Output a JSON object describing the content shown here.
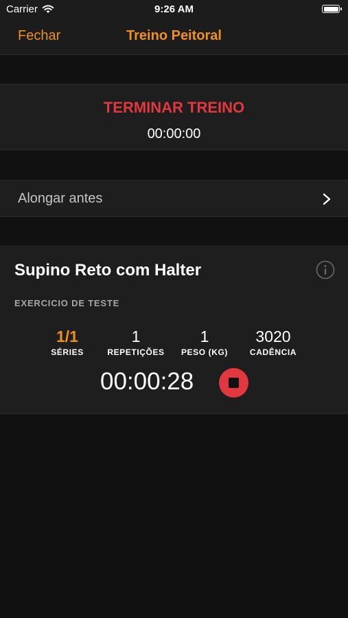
{
  "status_bar": {
    "carrier": "Carrier",
    "time": "9:26 AM"
  },
  "nav": {
    "close_label": "Fechar",
    "title": "Treino Peitoral"
  },
  "workout": {
    "finish_label": "TERMINAR TREINO",
    "elapsed": "00:00:00"
  },
  "stretch": {
    "label": "Alongar antes"
  },
  "exercise": {
    "title": "Supino Reto com Halter",
    "subtitle": "EXERCICIO DE TESTE",
    "stats": [
      {
        "value": "1/1",
        "label": "SÉRIES"
      },
      {
        "value": "1",
        "label": "REPETIÇÕES"
      },
      {
        "value": "1",
        "label": "PESO (KG)"
      },
      {
        "value": "3020",
        "label": "CADÊNCIA"
      }
    ],
    "rest_timer": "00:00:28"
  },
  "colors": {
    "accent": "#f0901e",
    "danger": "#e0383e",
    "background": "#111111",
    "cell": "#1e1e1e"
  },
  "icons": {
    "wifi": "wifi-icon",
    "battery": "battery-icon",
    "chevron": "chevron-right-icon",
    "info": "info-icon",
    "stop": "stop-icon"
  }
}
